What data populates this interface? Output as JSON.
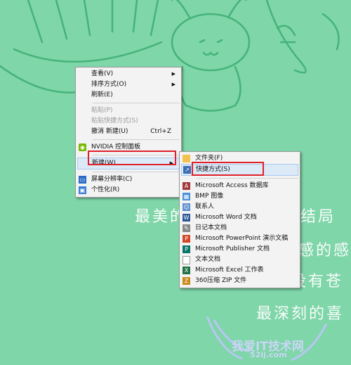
{
  "wallpaper": {
    "lines": [
      "最美的",
      "结局",
      "感的感",
      "没有苍",
      "最深刻的喜"
    ],
    "watermark_title": "我爱IT技术网",
    "watermark_url": "52ij.com"
  },
  "context_menu": {
    "items": [
      {
        "label": "查看(V)",
        "has_arrow": true
      },
      {
        "label": "排序方式(O)",
        "has_arrow": true
      },
      {
        "label": "刷新(E)"
      },
      {
        "label": "粘贴(P)",
        "disabled": true
      },
      {
        "label": "粘贴快捷方式(S)",
        "disabled": true
      },
      {
        "label": "撤消 新建(U)",
        "shortcut": "Ctrl+Z"
      },
      {
        "label": "NVIDIA 控制面板",
        "icon": "nvidia-icon"
      },
      {
        "label": "新建(W)",
        "has_arrow": true,
        "highlighted": true
      },
      {
        "label": "屏幕分辨率(C)",
        "icon": "display-icon"
      },
      {
        "label": "个性化(R)",
        "icon": "personalize-icon"
      }
    ]
  },
  "submenu": {
    "items": [
      {
        "label": "文件夹(F)",
        "icon": "folder-icon"
      },
      {
        "label": "快捷方式(S)",
        "icon": "shortcut-icon",
        "highlighted": true
      },
      {
        "label": "Microsoft Access 数据库",
        "icon": "access-icon"
      },
      {
        "label": "BMP 图像",
        "icon": "bmp-icon"
      },
      {
        "label": "联系人",
        "icon": "contact-icon"
      },
      {
        "label": "Microsoft Word 文档",
        "icon": "word-icon"
      },
      {
        "label": "日记本文档",
        "icon": "journal-icon"
      },
      {
        "label": "Microsoft PowerPoint 演示文稿",
        "icon": "powerpoint-icon"
      },
      {
        "label": "Microsoft Publisher 文档",
        "icon": "publisher-icon"
      },
      {
        "label": "文本文档",
        "icon": "text-icon"
      },
      {
        "label": "Microsoft Excel 工作表",
        "icon": "excel-icon"
      },
      {
        "label": "360压缩 ZIP 文件",
        "icon": "zip-icon"
      }
    ]
  },
  "colors": {
    "wallpaper": "#7fd6a9",
    "highlight_box": "#e0202a"
  }
}
